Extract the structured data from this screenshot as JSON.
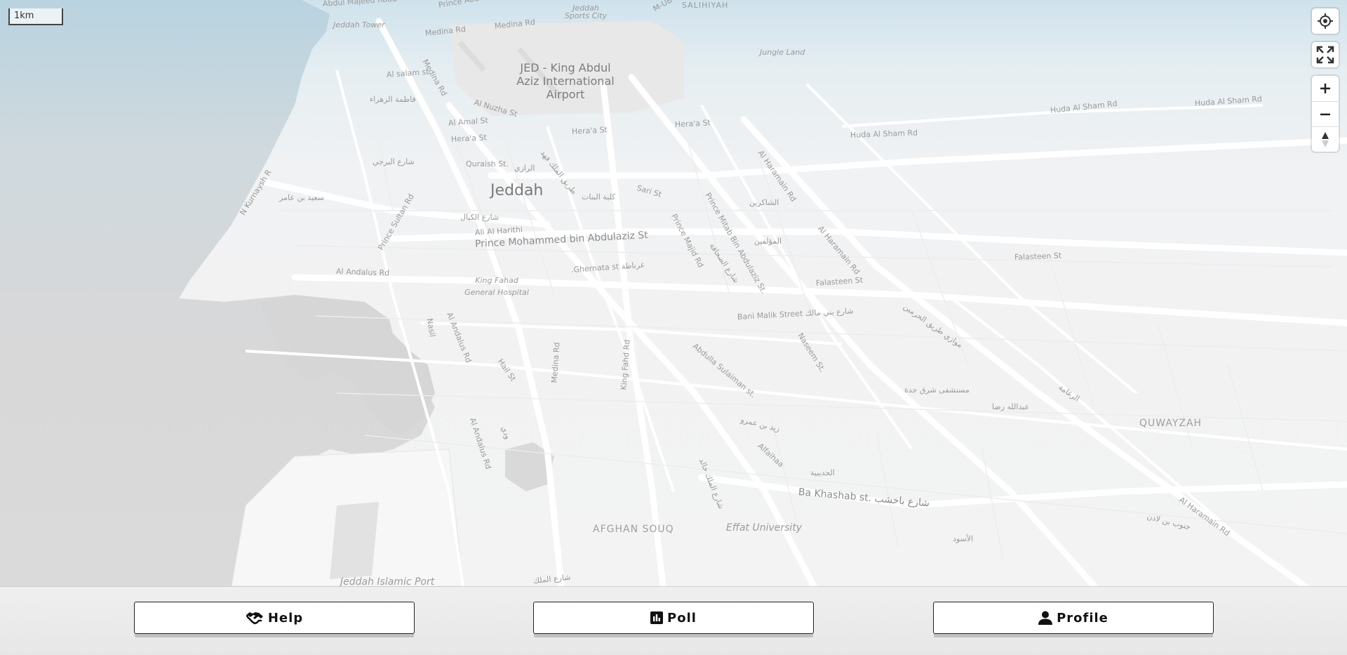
{
  "map": {
    "scale_label": "1km",
    "labels": {
      "jeddah": "Jeddah",
      "airport": "JED - King Abdul Aziz International Airport",
      "abdul_majeed_road": "Abdul Majeed Road",
      "prince_abd_allah": "Prince Abd Allah Al Faisal",
      "jeddah_tower": "Jeddah Tower",
      "jeddah_sports_city": "Jeddah Sports City",
      "mub": "M-UB",
      "salihiyah": "SALIHIYAH",
      "medina_rd_1": "Medina Rd",
      "medina_rd_2": "Medina Rd",
      "medina_rd_3": "Medina Rd",
      "medina_rd_4": "Medina Rd",
      "jungle_land": "Jungle Land",
      "al_salam_st": "Al salam st",
      "fatima_zahra": "فاطمة الزهراء",
      "al_nuzha_st": "Al Nuzha St",
      "al_amal_st": "Al Amal St",
      "heraa_st_1": "Hera'a St",
      "heraa_st_2": "Hera'a St",
      "heraa_st_3": "Hera'a St",
      "huda_al_sham_1": "Huda Al Sham Rd",
      "huda_al_sham_2": "Huda Al Sham Rd",
      "huda_al_sham_3": "Huda Al Sham Rd",
      "al_barjee": "شارع البرجي",
      "quraish_st": "Quraish St.",
      "al_razi": "الرازي",
      "king_fahd_rd_ar": "طريق الملك فهد",
      "n_kurnaysh": "N Kurnaysh R",
      "saeed_bin_amer": "سعيد بن عامر",
      "prince_sultan_rd": "Prince Sultan Rd",
      "sari_st": "Sari St",
      "kulliyat_albanat": "كلية البنات",
      "al_haramain_1": "Al Haramain Rd",
      "al_haramain_2": "Al Haramain Rd",
      "al_haramain_3": "Al Haramain Rd",
      "al_shakireen": "الشاكرين",
      "al_kayyal": "شارع الكيال",
      "ali_al_harithi": "Ali Al Harithi",
      "prince_mohammed": "Prince Mohammed bin Abdulaziz St",
      "prince_majid_rd": "Prince Majid Rd",
      "prince_mitab": "Prince Mitab Bin Abdulaziz St.",
      "al_muallifeen": "المؤلفين",
      "al_sahafa": "شارع الصحافة",
      "falasteen_1": "Falasteen St",
      "falasteen_2": "Falasteen St",
      "al_andalus_rd_1": "Al Andalus Rd",
      "al_andalus_rd_2": "Al Andalus Rd",
      "al_andalus_rd_3": "Al Andalus Rd",
      "king_fahad_hospital": "King Fahad General Hospital",
      "ghernata": ".Ghernata st غرناطة",
      "bani_malik": "Bani Malik Street شارع بني مالك",
      "mawazi_haram": "موازي طريق الحرمين",
      "nasil": "Nasil",
      "naseem_st": "Naseem St.",
      "hail_st": "Hail St",
      "king_fahd_rd": "King Fahd Rd",
      "abdulla_sulaiman": "Abdulla Sulaiman st.",
      "east_jeddah_hospital": "مستشفى شرق جدة",
      "al_raghama": "الرغامة",
      "abdullah_reda": "عبدالله رضا",
      "zaid_bin_amr": "زيد بن عمرو",
      "quwayzah": "QUWAYZAH",
      "alfaihaa": "Alfaihaa",
      "king_khalid": "شارع الملك خالد",
      "al_hudaybiyah": "الحديبية",
      "ba_khashab": "Ba Khashab st. شارع باخشب",
      "south_bin_ladin": "جنوب بن لادن",
      "afghan_souq": "AFGHAN SOUQ",
      "effat_university": "Effat University",
      "al_aswad": "الأسود",
      "jeddah_islamic_port": "Jeddah Islamic Port",
      "shariaa_bottom": "شارع الملك",
      "wadi": "ودي"
    }
  },
  "controls": {
    "locate_icon": "crosshair-locate-icon",
    "fullscreen_icon": "expand-fullscreen-icon",
    "zoom_in_icon": "plus-icon",
    "zoom_out_icon": "minus-icon",
    "compass_icon": "compass-north-icon"
  },
  "bottom_bar": {
    "help": {
      "label": "Help",
      "icon": "handshake-icon"
    },
    "poll": {
      "label": "Poll",
      "icon": "bar-chart-icon"
    },
    "profile": {
      "label": "Profile",
      "icon": "user-icon"
    }
  },
  "colors": {
    "water": "#c9d9e3",
    "water_gray": "#d6d6d6",
    "land": "#f3f3f3",
    "road": "#ffffff"
  }
}
